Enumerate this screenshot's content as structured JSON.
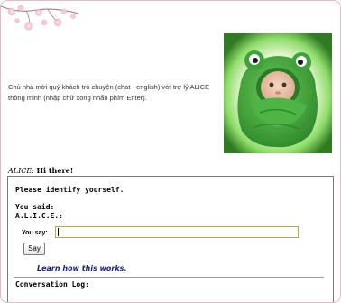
{
  "intro_text": "Chủ nhà mời quý khách trò chuyện (chat - english) với trợ lý ALICE thông minh (nhập chữ xong nhấn phím Enter).",
  "greeting": {
    "speaker": "ALICE:",
    "message": "Hi there!"
  },
  "chat": {
    "prompt": "Please identify yourself.",
    "you_said_label": "You said:",
    "alice_label": "A.L.I.C.E.:",
    "you_say_label": "You say:",
    "input_value": "",
    "say_button_label": "Say",
    "learn_link": "Learn how this works.",
    "log_title": "Conversation Log:"
  },
  "colors": {
    "page_border": "#e6b8c0",
    "link": "#1a237e",
    "input_border": "#c7a43a",
    "frog_green": "#3fa33a",
    "glow_green": "#8fdc6a"
  },
  "images": {
    "header_decoration": "cherry-blossom-branch",
    "photo": "baby-in-frog-towel"
  }
}
